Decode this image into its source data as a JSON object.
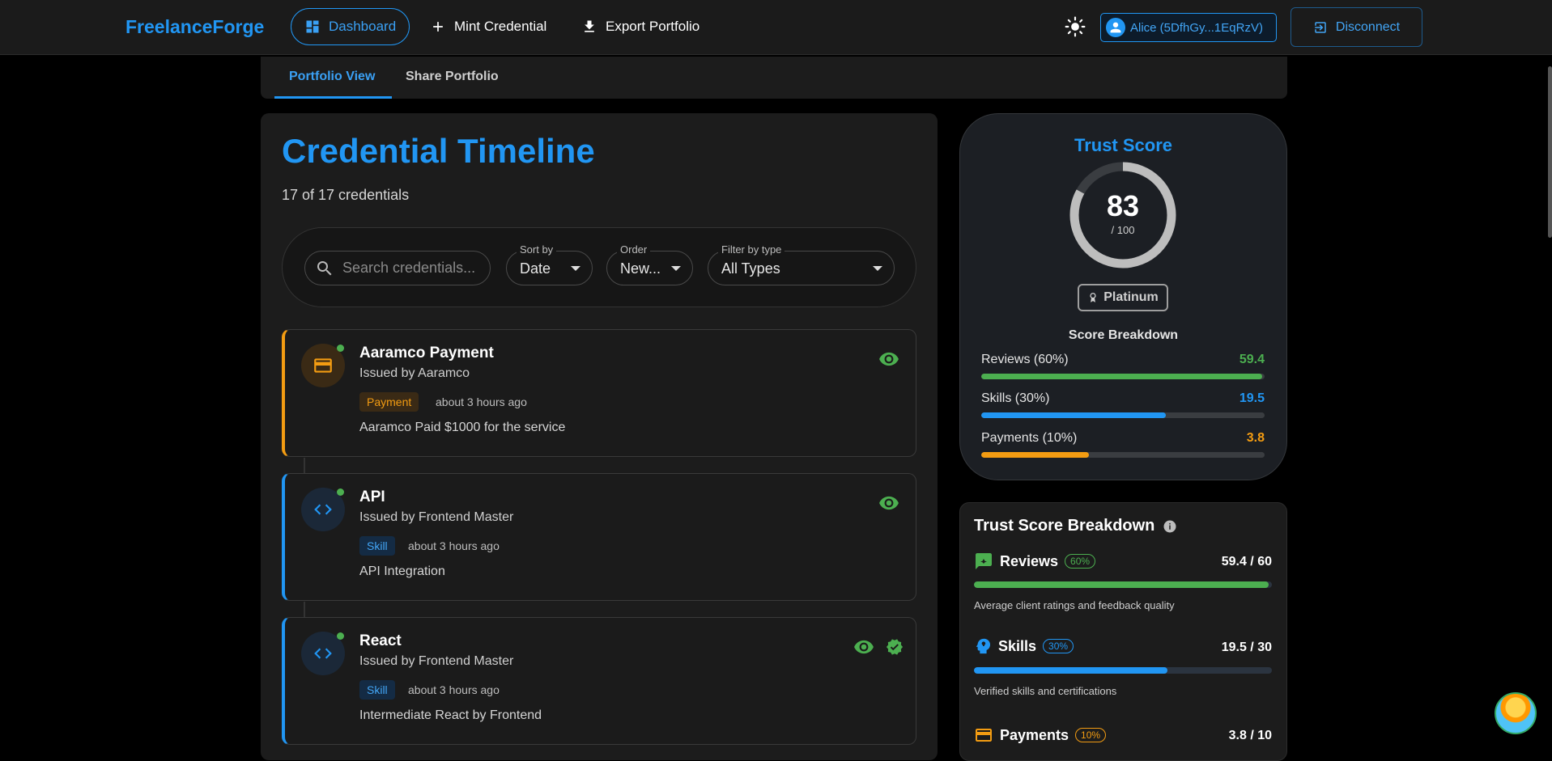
{
  "brand": "FreelanceForge",
  "nav": {
    "dashboard": "Dashboard",
    "mint": "Mint Credential",
    "export": "Export Portfolio"
  },
  "wallet": "Alice (5DfhGy...1EqRzV)",
  "disconnect": "Disconnect",
  "tabs": [
    "Portfolio View",
    "Share Portfolio"
  ],
  "timeline": {
    "title": "Credential Timeline",
    "count": "17 of 17 credentials",
    "search_placeholder": "Search credentials...",
    "sort": {
      "label": "Sort by",
      "value": "Date"
    },
    "order": {
      "label": "Order",
      "value": "New..."
    },
    "filter": {
      "label": "Filter by type",
      "value": "All Types"
    },
    "cards": [
      {
        "title": "Aaramco Payment",
        "issuer": "Issued by Aaramco",
        "badge": "Payment",
        "time": "about 3 hours ago",
        "desc": "Aaramco Paid $1000 for the service"
      },
      {
        "title": "API",
        "issuer": "Issued by Frontend Master",
        "badge": "Skill",
        "time": "about 3 hours ago",
        "desc": "API Integration"
      },
      {
        "title": "React",
        "issuer": "Issued by Frontend Master",
        "badge": "Skill",
        "time": "about 3 hours ago",
        "desc": "Intermediate React by Frontend"
      }
    ]
  },
  "trust": {
    "title": "Trust Score",
    "score": "83",
    "max": "/ 100",
    "score_fraction": 0.83,
    "tier": "Platinum",
    "breakdown_title": "Score Breakdown",
    "rows": [
      {
        "name": "Reviews (60%)",
        "value": "59.4",
        "fraction": 0.99,
        "color": "#4caf50"
      },
      {
        "name": "Skills (30%)",
        "value": "19.5",
        "fraction": 0.65,
        "color": "#2196f3"
      },
      {
        "name": "Payments (10%)",
        "value": "3.8",
        "fraction": 0.38,
        "color": "#f39c12"
      }
    ]
  },
  "tsb": {
    "title": "Trust Score Breakdown",
    "rows": [
      {
        "name": "Reviews",
        "pct": "60%",
        "score": "59.4 / 60",
        "fraction": 0.99,
        "color": "#4caf50",
        "note": "Average client ratings and feedback quality"
      },
      {
        "name": "Skills",
        "pct": "30%",
        "score": "19.5 / 30",
        "fraction": 0.65,
        "color": "#2196f3",
        "note": "Verified skills and certifications"
      },
      {
        "name": "Payments",
        "pct": "10%",
        "score": "3.8 / 10",
        "fraction": 0.38,
        "color": "#f39c12",
        "note": ""
      }
    ]
  }
}
